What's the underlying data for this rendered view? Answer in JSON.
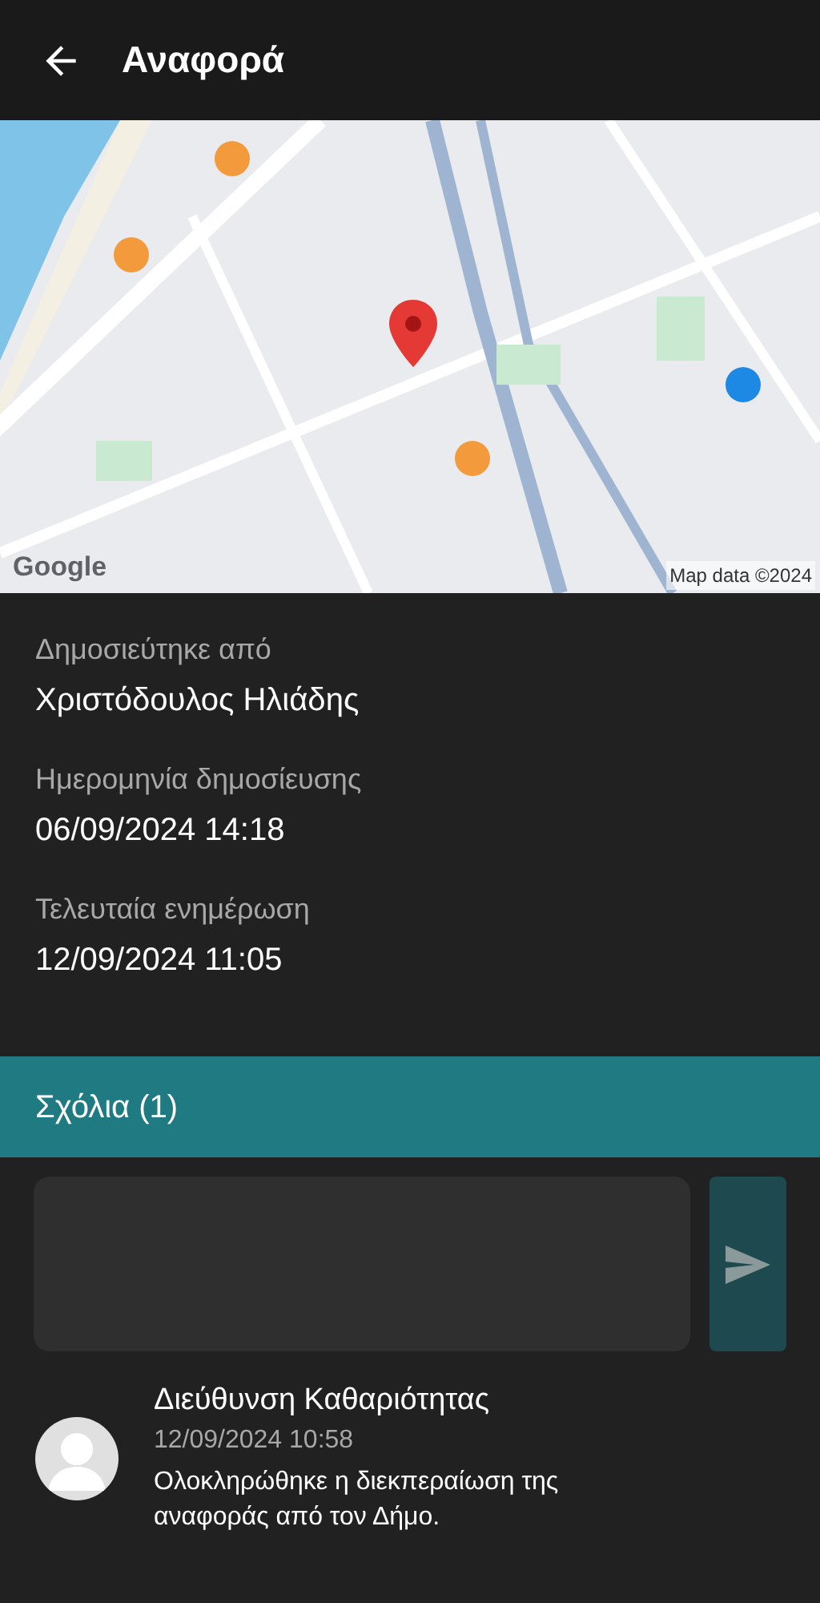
{
  "app_bar": {
    "title": "Αναφορά"
  },
  "map": {
    "attribution": "Map data ©2024",
    "logo_text": "Google"
  },
  "details": [
    {
      "label": "Δημοσιεύτηκε από",
      "value": "Χριστόδουλος Ηλιάδης"
    },
    {
      "label": "Ημερομηνία δημοσίευσης",
      "value": "06/09/2024 14:18"
    },
    {
      "label": "Τελευταία ενημέρωση",
      "value": "12/09/2024 11:05"
    }
  ],
  "comments_header": "Σχόλια (1)",
  "comment_input": {
    "send_disabled": true
  },
  "comments": [
    {
      "author": "Διεύθυνση Καθαριότητας",
      "date": "12/09/2024 10:58",
      "text": "Ολοκληρώθηκε η διεκπεραίωση της αναφοράς από τον Δήμο."
    }
  ]
}
